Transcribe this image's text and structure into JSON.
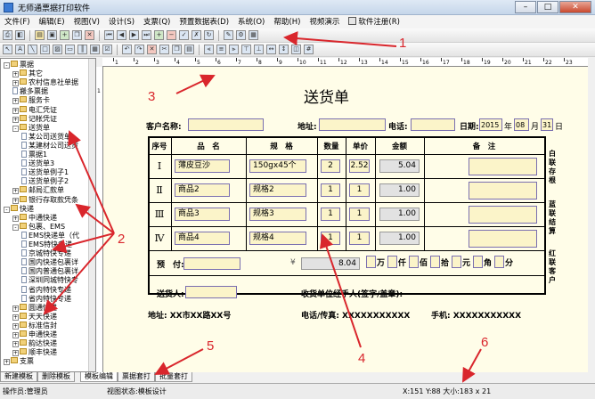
{
  "window": {
    "title": "无师通票据打印软件"
  },
  "menu": [
    "文件(F)",
    "编辑(E)",
    "视图(V)",
    "设计(S)",
    "支票(Q)",
    "预置数据表(D)",
    "系统(O)",
    "帮助(H)",
    "视频演示",
    "软件注册(R)"
  ],
  "tree": [
    {
      "label": "票据",
      "level": 0,
      "kind": "folder",
      "exp": "-"
    },
    {
      "label": "其它",
      "level": 1,
      "kind": "folder",
      "exp": "+"
    },
    {
      "label": "农村信息社单据",
      "level": 1,
      "kind": "folder",
      "exp": "+"
    },
    {
      "label": "搬多票据",
      "level": 1,
      "kind": "doc",
      "exp": ""
    },
    {
      "label": "服务卡",
      "level": 1,
      "kind": "folder",
      "exp": "+"
    },
    {
      "label": "电汇凭证",
      "level": 1,
      "kind": "folder",
      "exp": "+"
    },
    {
      "label": "记帐凭证",
      "level": 1,
      "kind": "folder",
      "exp": "+"
    },
    {
      "label": "送货单",
      "level": 1,
      "kind": "folder",
      "exp": "-"
    },
    {
      "label": "某公司送货单",
      "level": 2,
      "kind": "doc",
      "exp": ""
    },
    {
      "label": "某建材公司送货",
      "level": 2,
      "kind": "doc",
      "exp": ""
    },
    {
      "label": "票据1",
      "level": 2,
      "kind": "doc",
      "exp": ""
    },
    {
      "label": "送货单3",
      "level": 2,
      "kind": "doc",
      "exp": ""
    },
    {
      "label": "送货单例子1",
      "level": 2,
      "kind": "doc",
      "exp": ""
    },
    {
      "label": "送货单例子2",
      "level": 2,
      "kind": "doc",
      "exp": ""
    },
    {
      "label": "邮局汇款单",
      "level": 1,
      "kind": "folder",
      "exp": "+"
    },
    {
      "label": "银行存取款凭条",
      "level": 1,
      "kind": "folder",
      "exp": "+"
    },
    {
      "label": "快递",
      "level": 0,
      "kind": "folder",
      "exp": "-"
    },
    {
      "label": "中通快递",
      "level": 1,
      "kind": "folder",
      "exp": "+"
    },
    {
      "label": "包裹、EMS",
      "level": 1,
      "kind": "folder",
      "exp": "-"
    },
    {
      "label": "EMS快递单（代",
      "level": 2,
      "kind": "doc",
      "exp": ""
    },
    {
      "label": "EMS特快专递",
      "level": 2,
      "kind": "doc",
      "exp": ""
    },
    {
      "label": "京城特快专递",
      "level": 2,
      "kind": "doc",
      "exp": ""
    },
    {
      "label": "国内快递包裹详",
      "level": 2,
      "kind": "doc",
      "exp": ""
    },
    {
      "label": "国内普通包裹详",
      "level": 2,
      "kind": "doc",
      "exp": ""
    },
    {
      "label": "深圳同城特快专",
      "level": 2,
      "kind": "doc",
      "exp": ""
    },
    {
      "label": "省内特快专递",
      "level": 2,
      "kind": "doc",
      "exp": ""
    },
    {
      "label": "省内特快专递",
      "level": 2,
      "kind": "doc",
      "exp": ""
    },
    {
      "label": "圆通快递",
      "level": 1,
      "kind": "folder",
      "exp": "+"
    },
    {
      "label": "天天快递",
      "level": 1,
      "kind": "folder",
      "exp": "+"
    },
    {
      "label": "标准信封",
      "level": 1,
      "kind": "folder",
      "exp": "+"
    },
    {
      "label": "申通快递",
      "level": 1,
      "kind": "folder",
      "exp": "+"
    },
    {
      "label": "韵达快递",
      "level": 1,
      "kind": "folder",
      "exp": "+"
    },
    {
      "label": "顺丰快递",
      "level": 1,
      "kind": "folder",
      "exp": "+"
    },
    {
      "label": "支票",
      "level": 0,
      "kind": "folder",
      "exp": "+"
    }
  ],
  "tree_tabs": [
    "新建模板",
    "删除模板",
    "模板编辑",
    "票据套打",
    "批量套打"
  ],
  "statusbar": {
    "operator": "操作员:管理员",
    "state": "视图状态:模板设计",
    "coords": "X:151 Y:88 大小:183 x 21"
  },
  "form": {
    "title": "送货单",
    "customer_label": "客户名称:",
    "address_label": "地址:",
    "phone_label": "电话:",
    "date_label": "日期:",
    "year": "2015",
    "year_unit": "年",
    "month": "08",
    "month_unit": "月",
    "day": "31",
    "day_unit": "日",
    "headers": [
      "序号",
      "品　名",
      "规　格",
      "数量",
      "单价",
      "金额",
      "备　注"
    ],
    "rows": [
      {
        "no": "Ⅰ",
        "name": "薄皮豆沙",
        "spec": "150gx45个",
        "qty": "2",
        "price": "2.52",
        "amount": "5.04"
      },
      {
        "no": "Ⅱ",
        "name": "商品2",
        "spec": "规格2",
        "qty": "1",
        "price": "1",
        "amount": "1.00"
      },
      {
        "no": "Ⅲ",
        "name": "商品3",
        "spec": "规格3",
        "qty": "1",
        "price": "1",
        "amount": "1.00"
      },
      {
        "no": "Ⅳ",
        "name": "商品4",
        "spec": "规格4",
        "qty": "1",
        "price": "1",
        "amount": "1.00"
      }
    ],
    "prepaid_label": "预　付:",
    "yen": "¥",
    "total": "8.04",
    "big_units": [
      "万",
      "仟",
      "佰",
      "拾",
      "元",
      "角",
      "分"
    ],
    "deliverer_label": "送货人:",
    "receiver_label": "收货单位经手人(签字/盖章):",
    "side_labels": [
      "白联　存根",
      "蓝联　结算",
      "红联　客户"
    ],
    "footer_address": "地址: XX市XX路XX号",
    "footer_phone": "电话/传真: XXXXXXXXXXX",
    "footer_mobile": "手机: XXXXXXXXXXX"
  },
  "annotations": [
    "1",
    "2",
    "3",
    "4",
    "5",
    "6"
  ],
  "ruler_numbers": [
    "1",
    "2",
    "3",
    "4",
    "5",
    "6",
    "7",
    "8",
    "9",
    "10",
    "11",
    "12",
    "13",
    "14",
    "15",
    "16",
    "17",
    "18",
    "19",
    "20",
    "21",
    "22",
    "23"
  ],
  "accent_colors": {
    "annotation": "#d9262c",
    "field_border": "#7a6fb0",
    "field_fill": "#fbf4c9"
  }
}
